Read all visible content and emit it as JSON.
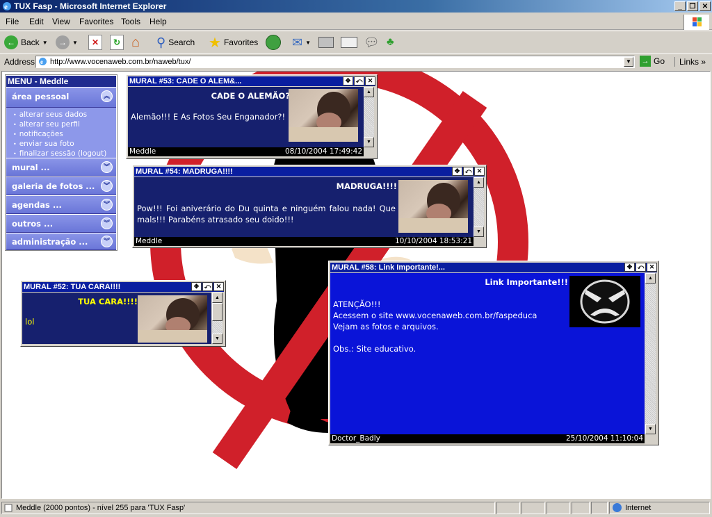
{
  "window": {
    "title": "TUX Fasp - Microsoft Internet Explorer"
  },
  "menubar": {
    "items": [
      "File",
      "Edit",
      "View",
      "Favorites",
      "Tools",
      "Help"
    ]
  },
  "toolbar": {
    "back": "Back",
    "search": "Search",
    "favorites": "Favorites"
  },
  "address": {
    "label": "Address",
    "url": "http://www.vocenaweb.com.br/naweb/tux/",
    "go": "Go",
    "links": "Links"
  },
  "status": {
    "text": "Meddle (2000 pontos) - nível 255 para 'TUX Fasp'",
    "zone": "Internet"
  },
  "menu": {
    "title": "MENU - Meddle",
    "sections": [
      {
        "label": "área pessoal"
      },
      {
        "label": "mural ..."
      },
      {
        "label": "galeria de fotos ..."
      },
      {
        "label": "agendas ..."
      },
      {
        "label": "outros ..."
      },
      {
        "label": "administração ..."
      }
    ],
    "subitems": [
      "alterar seus dados",
      "alterar seu perfil",
      "notificações",
      "enviar sua foto",
      "finalizar sessão (logout)"
    ]
  },
  "murals": {
    "m53": {
      "head": "MURAL #53: CADE O ALEM&...",
      "title": "CADE O ALEMÃO?",
      "text": "Alemão!!! E As Fotos Seu Enganador?!",
      "author": "Meddle",
      "date": "08/10/2004 17:49:42"
    },
    "m54": {
      "head": "MURAL #54: MADRUGA!!!!",
      "title": "MADRUGA!!!!",
      "text": "Pow!!! Foi aniverário do Du quinta e ninguém falou nada! Que mals!!! Parabéns atrasado seu doido!!!",
      "author": "Meddle",
      "date": "10/10/2004 18:53:21"
    },
    "m52": {
      "head": "MURAL #52: TUA CARA!!!!",
      "title": "TUA CARA!!!!",
      "text": "lol"
    },
    "m58": {
      "head": "MURAL #58: Link Importante!...",
      "title": "Link Importante!!!",
      "lines": [
        "ATENÇÃO!!!",
        "Acessem o site www.vocenaweb.com.br/faspeduca",
        "Vejam as fotos e arquivos.",
        "",
        "Obs.: Site educativo."
      ],
      "author": "Doctor_Badly",
      "date": "25/10/2004 11:10:04"
    }
  },
  "colors": {
    "title_bar": "#0a246a",
    "mural_body": "#16206e",
    "mural58_body": "#0a14d8",
    "sign_red": "#d0202a",
    "mural_title_yellow": "#ffff00"
  }
}
